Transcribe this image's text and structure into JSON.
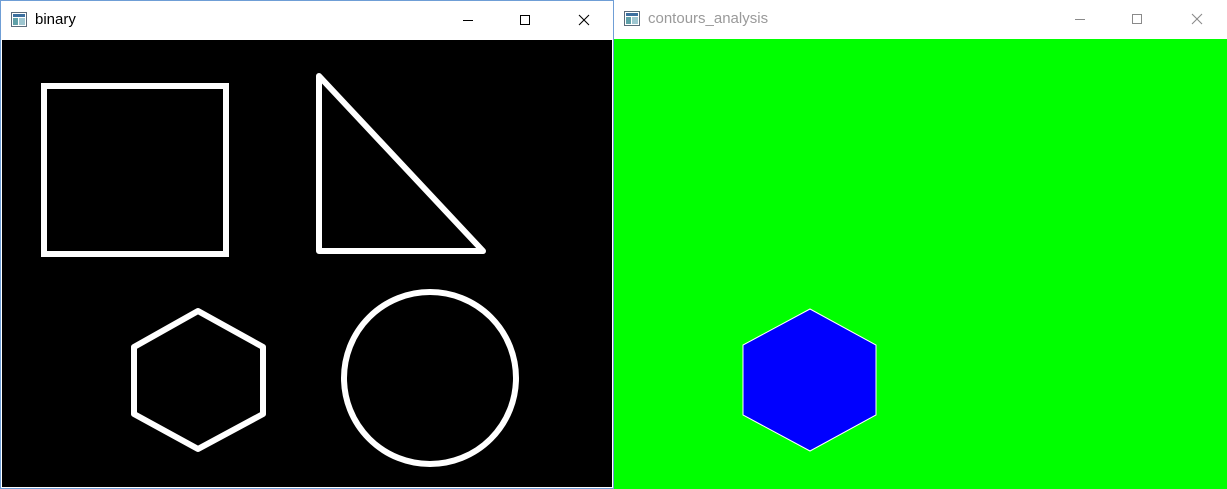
{
  "windows": [
    {
      "id": "binary",
      "title": "binary",
      "active": true,
      "title_color": "#000000",
      "content_background": "#000000",
      "shape_stroke": "#ffffff",
      "shapes": [
        "square-outline",
        "right-triangle-outline",
        "hexagon-outline",
        "circle-outline"
      ],
      "controls": [
        "minimize-icon",
        "maximize-icon",
        "close-icon"
      ]
    },
    {
      "id": "contours",
      "title": "contours_analysis",
      "active": false,
      "title_color": "#9a9a9a",
      "content_background": "#00ff00",
      "shape_fill": "#0000ff",
      "shapes": [
        "hexagon-filled"
      ],
      "controls": [
        "minimize-icon",
        "maximize-icon",
        "close-icon"
      ]
    }
  ]
}
